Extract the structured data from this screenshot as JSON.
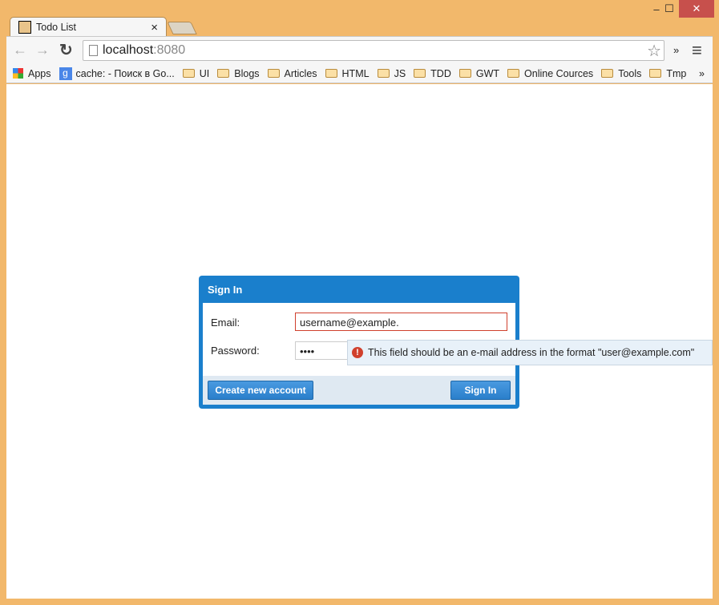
{
  "window": {
    "minimize": "–",
    "maximize": "☐",
    "close": "✕",
    "close_color": "#c7504c",
    "frame_color": "#f2b86b"
  },
  "tab": {
    "title": "Todo List",
    "close": "×"
  },
  "toolbar": {
    "back": "←",
    "forward": "→",
    "reload": "↻",
    "url_host": "localhost",
    "url_port": ":8080",
    "star": "☆",
    "more": "»",
    "menu": "≡"
  },
  "bookmarks": {
    "items": [
      {
        "label": "Apps",
        "icon": "apps-grid-icon"
      },
      {
        "label": "cache: - Поиск в Go...",
        "icon": "google-icon"
      },
      {
        "label": "UI",
        "icon": "folder-icon"
      },
      {
        "label": "Blogs",
        "icon": "folder-icon"
      },
      {
        "label": "Articles",
        "icon": "folder-icon"
      },
      {
        "label": "HTML",
        "icon": "folder-icon"
      },
      {
        "label": "JS",
        "icon": "folder-icon"
      },
      {
        "label": "TDD",
        "icon": "folder-icon"
      },
      {
        "label": "GWT",
        "icon": "folder-icon"
      },
      {
        "label": "Online Cources",
        "icon": "folder-icon"
      },
      {
        "label": "Tools",
        "icon": "folder-icon"
      },
      {
        "label": "Tmp",
        "icon": "folder-icon"
      }
    ],
    "overflow": "»"
  },
  "dialog": {
    "title": "Sign In",
    "email_label": "Email:",
    "email_value": "username@example.",
    "password_label": "Password:",
    "password_value": "••••",
    "create_button": "Create new account",
    "signin_button": "Sign In",
    "accent": "#1a7fcc",
    "error_border": "#d0402d"
  },
  "tooltip": {
    "icon": "!",
    "message": "This field should be an e-mail address in the format \"user@example.com\""
  }
}
